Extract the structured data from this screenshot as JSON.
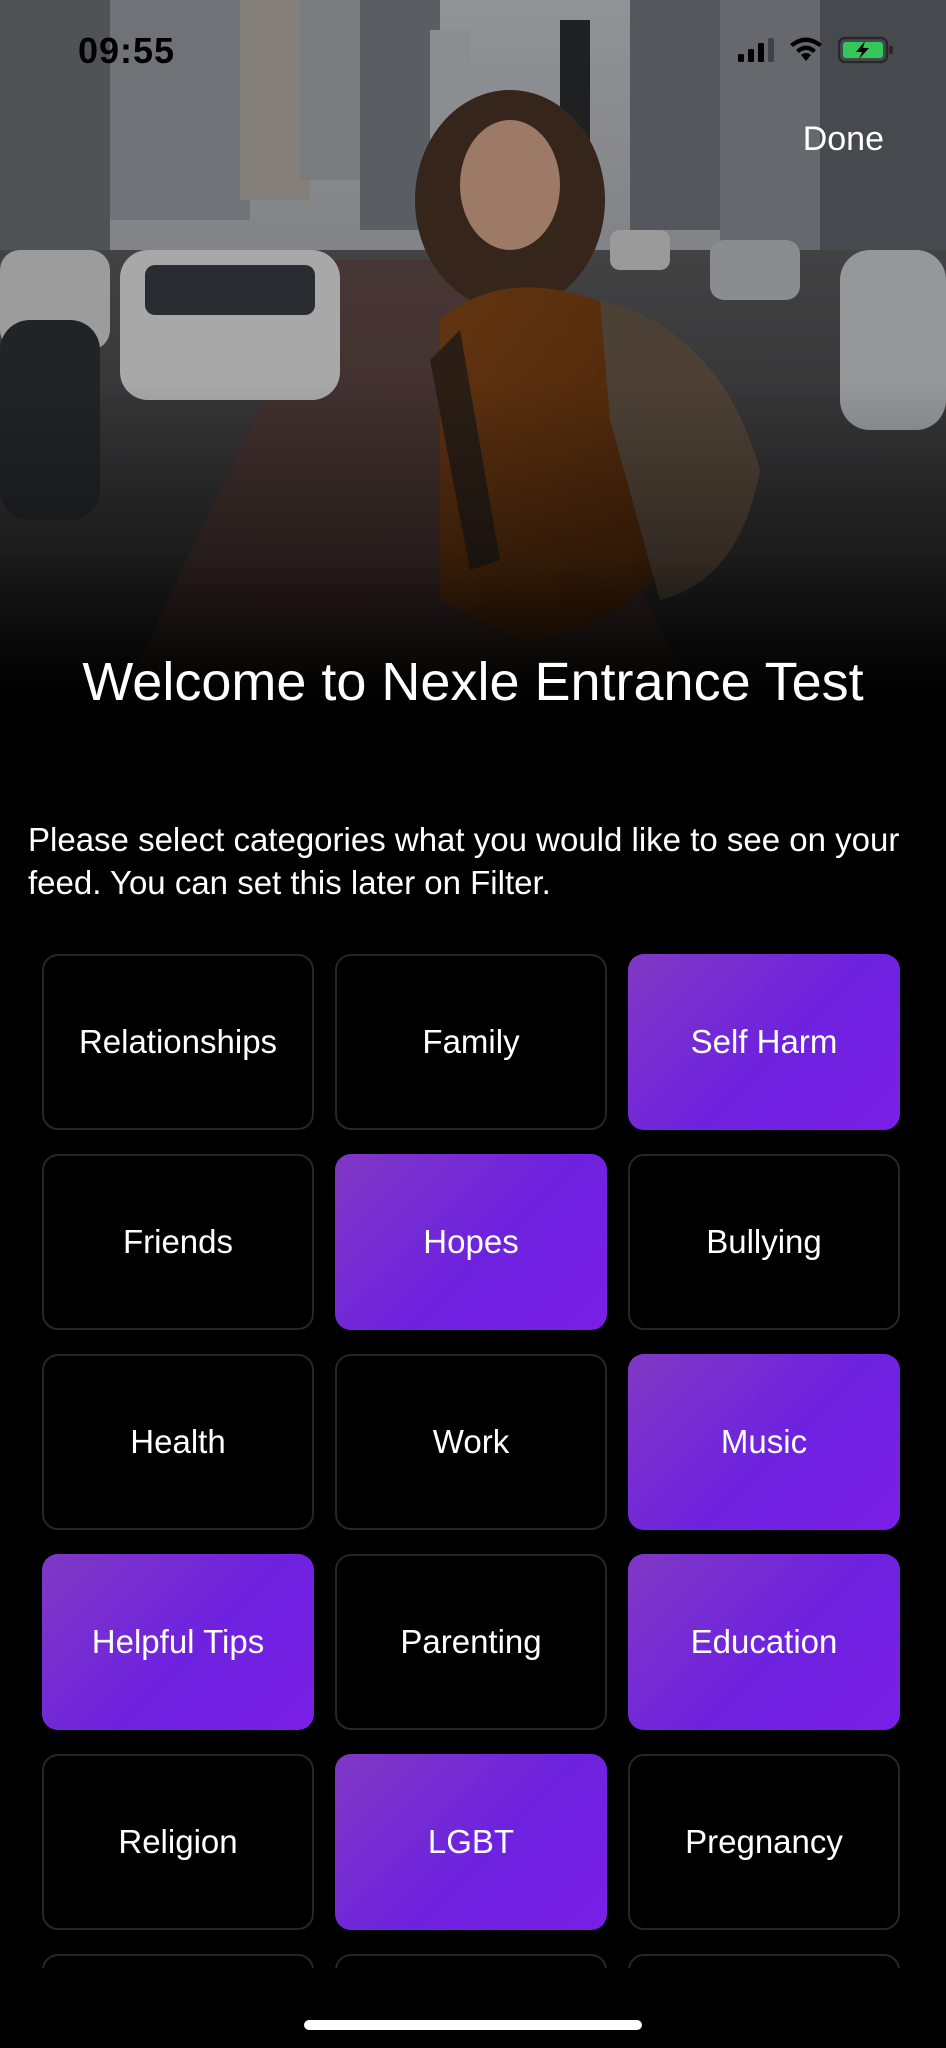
{
  "status_bar": {
    "time": "09:55"
  },
  "header": {
    "done_label": "Done"
  },
  "welcome": {
    "title": "Welcome to Nexle Entrance Test",
    "description": "Please select categories what you would like to see on your feed. You can set this later on Filter."
  },
  "categories": [
    {
      "label": "Relationships",
      "selected": false
    },
    {
      "label": "Family",
      "selected": false
    },
    {
      "label": "Self Harm",
      "selected": true
    },
    {
      "label": "Friends",
      "selected": false
    },
    {
      "label": "Hopes",
      "selected": true
    },
    {
      "label": "Bullying",
      "selected": false
    },
    {
      "label": "Health",
      "selected": false
    },
    {
      "label": "Work",
      "selected": false
    },
    {
      "label": "Music",
      "selected": true
    },
    {
      "label": "Helpful Tips",
      "selected": true
    },
    {
      "label": "Parenting",
      "selected": false
    },
    {
      "label": "Education",
      "selected": true
    },
    {
      "label": "Religion",
      "selected": false
    },
    {
      "label": "LGBT",
      "selected": true
    },
    {
      "label": "Pregnancy",
      "selected": false
    },
    {
      "label": "",
      "selected": false
    },
    {
      "label": "",
      "selected": false
    },
    {
      "label": "",
      "selected": false
    }
  ],
  "colors": {
    "selected_tile_start": "#8038c4",
    "selected_tile_end": "#7a1fe6",
    "tile_border": "#262626",
    "background": "#000000",
    "battery_fill": "#34c759"
  },
  "icons": {
    "signal": "cellular-signal-icon",
    "wifi": "wifi-icon",
    "battery": "battery-charging-icon"
  }
}
